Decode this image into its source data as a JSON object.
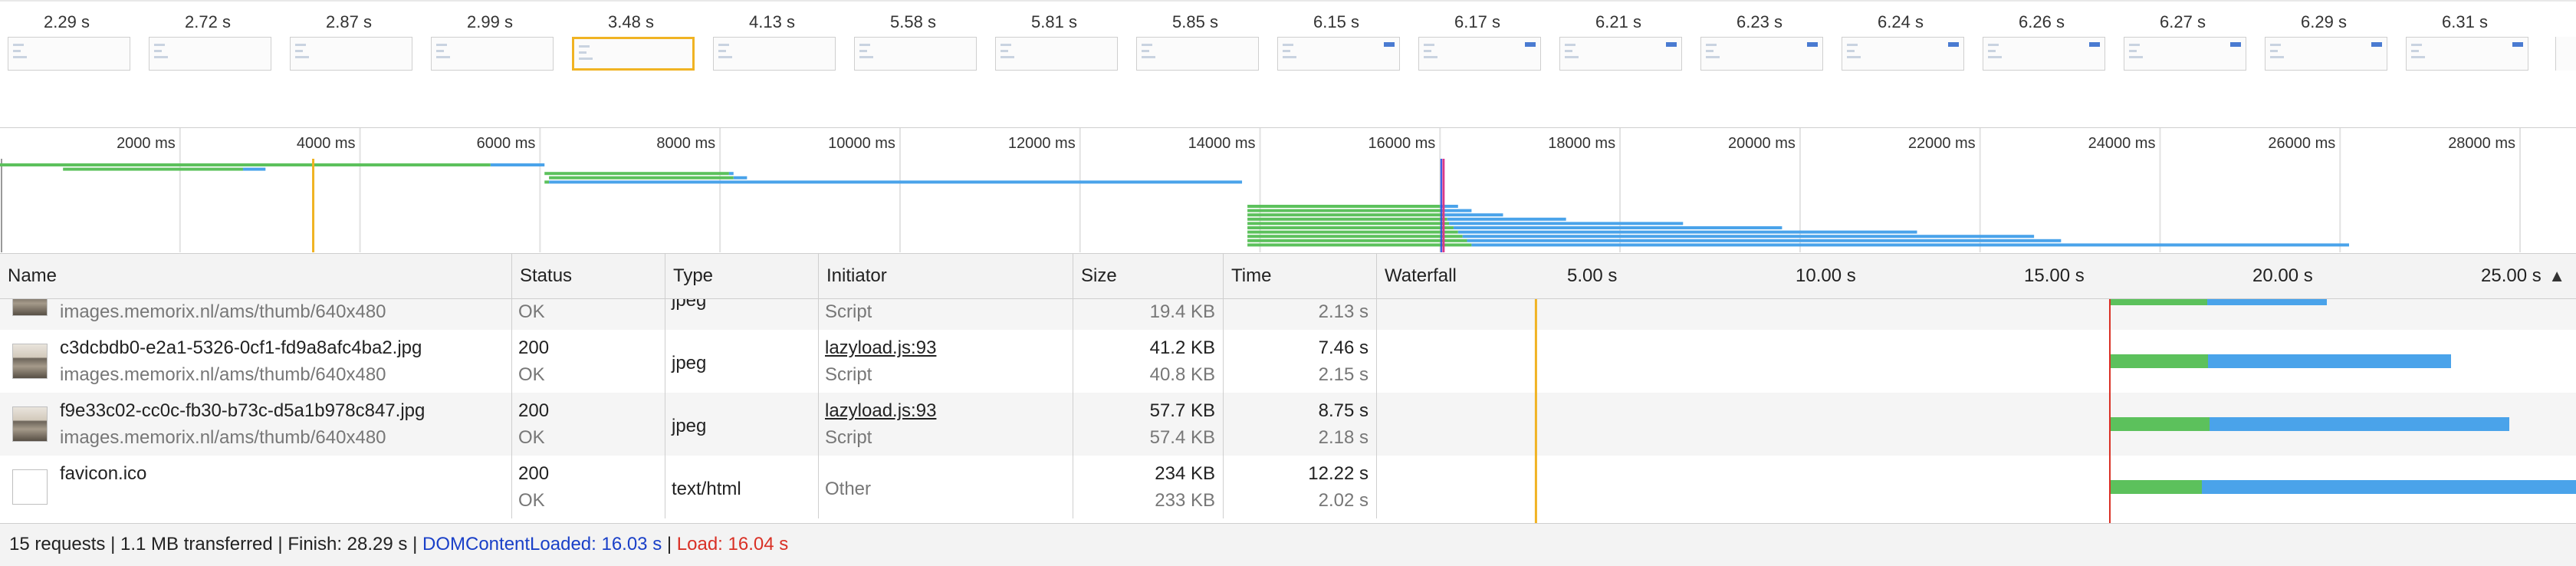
{
  "filmstrip": {
    "frames": [
      {
        "time": "2.29 s",
        "state": "empty"
      },
      {
        "time": "2.72 s",
        "state": "empty"
      },
      {
        "time": "2.87 s",
        "state": "empty"
      },
      {
        "time": "2.99 s",
        "state": "empty"
      },
      {
        "time": "3.48 s",
        "state": "selected"
      },
      {
        "time": "4.13 s",
        "state": "empty"
      },
      {
        "time": "5.58 s",
        "state": "empty"
      },
      {
        "time": "5.81 s",
        "state": "empty"
      },
      {
        "time": "5.85 s",
        "state": "empty"
      },
      {
        "time": "6.15 s",
        "state": "loaded"
      },
      {
        "time": "6.17 s",
        "state": "loaded"
      },
      {
        "time": "6.21 s",
        "state": "loaded"
      },
      {
        "time": "6.23 s",
        "state": "loaded"
      },
      {
        "time": "6.24 s",
        "state": "loaded"
      },
      {
        "time": "6.26 s",
        "state": "loaded"
      },
      {
        "time": "6.27 s",
        "state": "loaded"
      },
      {
        "time": "6.29 s",
        "state": "loaded"
      },
      {
        "time": "6.31 s",
        "state": "loaded"
      }
    ]
  },
  "overview": {
    "tick_labels": [
      "2000 ms",
      "4000 ms",
      "6000 ms",
      "8000 ms",
      "10000 ms",
      "12000 ms",
      "14000 ms",
      "16000 ms",
      "18000 ms",
      "20000 ms",
      "22000 ms",
      "24000 ms",
      "26000 ms",
      "28000 ms"
    ],
    "ticks_ms": [
      2000,
      4000,
      6000,
      8000,
      10000,
      12000,
      14000,
      16000,
      18000,
      20000,
      22000,
      24000,
      26000,
      28000
    ],
    "dom_content_loaded_ms": 16030,
    "load_ms": 16040,
    "marker_ms": 3480,
    "requests": [
      {
        "start": 0,
        "wait_end": 5450,
        "end": 6050
      },
      {
        "start": 700,
        "wait_end": 2700,
        "end": 2950
      },
      {
        "start": 6050,
        "wait_end": 8100,
        "end": 8150
      },
      {
        "start": 6100,
        "wait_end": 8150,
        "end": 8300
      },
      {
        "start": 6050,
        "wait_end": 6100,
        "end": 13800
      },
      {
        "start": 13860,
        "wait_end": 16000,
        "end": 16200
      },
      {
        "start": 13860,
        "wait_end": 16020,
        "end": 16350
      },
      {
        "start": 13860,
        "wait_end": 16050,
        "end": 16700
      },
      {
        "start": 13860,
        "wait_end": 16080,
        "end": 17400
      },
      {
        "start": 13860,
        "wait_end": 16100,
        "end": 18700
      },
      {
        "start": 13860,
        "wait_end": 16150,
        "end": 19800
      },
      {
        "start": 13860,
        "wait_end": 16200,
        "end": 21300
      },
      {
        "start": 13860,
        "wait_end": 16250,
        "end": 22600
      },
      {
        "start": 13860,
        "wait_end": 16300,
        "end": 22900
      },
      {
        "start": 13860,
        "wait_end": 16350,
        "end": 26100
      }
    ]
  },
  "columns": {
    "name": "Name",
    "status": "Status",
    "type": "Type",
    "initiator": "Initiator",
    "size": "Size",
    "time": "Time",
    "waterfall": "Waterfall"
  },
  "waterfall_scale": {
    "tick_labels": [
      "5.00 s",
      "10.00 s",
      "15.00 s",
      "20.00 s",
      "25.00 s"
    ],
    "ticks_s": [
      5,
      10,
      15,
      20,
      25
    ],
    "marker_s": 3.48,
    "load_s": 16.04,
    "sort_indicator": "▲"
  },
  "rows": [
    {
      "icon": "image",
      "name": "",
      "domain": "images.memorix.nl/ams/thumb/640x480",
      "status": "",
      "status_text": "OK",
      "type": "jpeg",
      "initiator": "",
      "initiator_type": "Script",
      "size": "",
      "size_resource": "19.4 KB",
      "time": "",
      "latency": "2.13 s",
      "start_s": 16.04,
      "wait_s": 2.13,
      "total_s": 4.75
    },
    {
      "icon": "image",
      "name": "c3dcbdb0-e2a1-5326-0cf1-fd9a8afc4ba2.jpg",
      "domain": "images.memorix.nl/ams/thumb/640x480",
      "status": "200",
      "status_text": "OK",
      "type": "jpeg",
      "initiator": "lazyload.js:93",
      "initiator_type": "Script",
      "size": "41.2 KB",
      "size_resource": "40.8 KB",
      "time": "7.46 s",
      "latency": "2.15 s",
      "start_s": 16.04,
      "wait_s": 2.15,
      "total_s": 7.46
    },
    {
      "icon": "image",
      "name": "f9e33c02-cc0c-fb30-b73c-d5a1b978c847.jpg",
      "domain": "images.memorix.nl/ams/thumb/640x480",
      "status": "200",
      "status_text": "OK",
      "type": "jpeg",
      "initiator": "lazyload.js:93",
      "initiator_type": "Script",
      "size": "57.7 KB",
      "size_resource": "57.4 KB",
      "time": "8.75 s",
      "latency": "2.18 s",
      "start_s": 16.04,
      "wait_s": 2.18,
      "total_s": 8.75
    },
    {
      "icon": "blank",
      "name": "favicon.ico",
      "domain": "",
      "status": "200",
      "status_text": "OK",
      "type": "text/html",
      "initiator": "",
      "initiator_type": "Other",
      "size": "234 KB",
      "size_resource": "233 KB",
      "time": "12.22 s",
      "latency": "2.02 s",
      "start_s": 16.04,
      "wait_s": 2.02,
      "total_s": 12.22
    }
  ],
  "status_bar": {
    "requests": "15 requests",
    "transferred": "1.1 MB transferred",
    "finish": "Finish: 28.29 s",
    "dom_content_loaded": "DOMContentLoaded: 16.03 s",
    "load": "Load: 16.04 s",
    "dcl_color": "#1a40c8",
    "load_color": "#d93025"
  },
  "colors": {
    "waiting": "#5cc15c",
    "download": "#4aa3ea",
    "dcl_line": "#2a4fe0",
    "load_line": "#d93a8a",
    "marker_line": "#f0b323"
  }
}
